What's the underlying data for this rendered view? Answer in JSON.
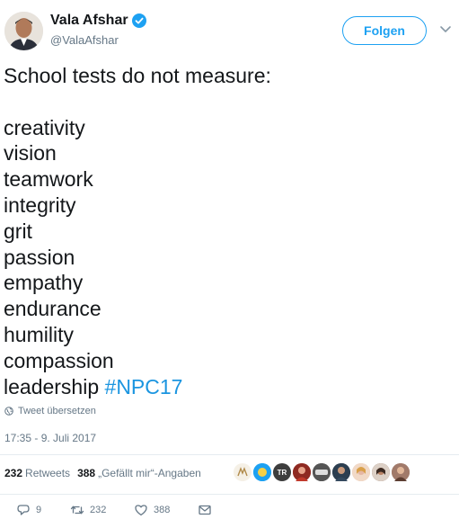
{
  "user": {
    "display_name": "Vala Afshar",
    "handle": "@ValaAfshar",
    "verified": true
  },
  "follow_button": {
    "label": "Folgen"
  },
  "tweet": {
    "lines": [
      "School tests do not measure:",
      "",
      "creativity",
      "vision",
      "teamwork",
      "integrity",
      "grit",
      "passion",
      "empathy",
      "endurance",
      "humility",
      "compassion",
      "leadership"
    ],
    "hashtag": "#NPC17"
  },
  "translate_label": "Tweet übersetzen",
  "timestamp": "17:35 - 9. Juli 2017",
  "stats": {
    "retweets_count": "232",
    "retweets_label": "Retweets",
    "likes_count": "388",
    "likes_label": "„Gefällt mir“-Angaben"
  },
  "likers": [
    {
      "icon": "avatar-icon",
      "color": "#f5f0e6"
    },
    {
      "icon": "avatar-icon",
      "color": "#1da1f2"
    },
    {
      "icon": "avatar-icon",
      "color": "#3d3d3d",
      "text": "TR"
    },
    {
      "icon": "avatar-icon",
      "color": "#c0392b"
    },
    {
      "icon": "avatar-icon",
      "color": "#555555"
    },
    {
      "icon": "avatar-icon",
      "color": "#2c3e50"
    },
    {
      "icon": "avatar-icon",
      "color": "#e5b7a5"
    },
    {
      "icon": "avatar-icon",
      "color": "#7a4b3a"
    },
    {
      "icon": "avatar-icon",
      "color": "#a17a6a"
    }
  ],
  "actions": {
    "reply_count": "9",
    "retweet_count": "232",
    "like_count": "388"
  },
  "colors": {
    "accent": "#1da1f2",
    "hashtag": "#1b95e0",
    "muted": "#657786",
    "text": "#14171a"
  }
}
